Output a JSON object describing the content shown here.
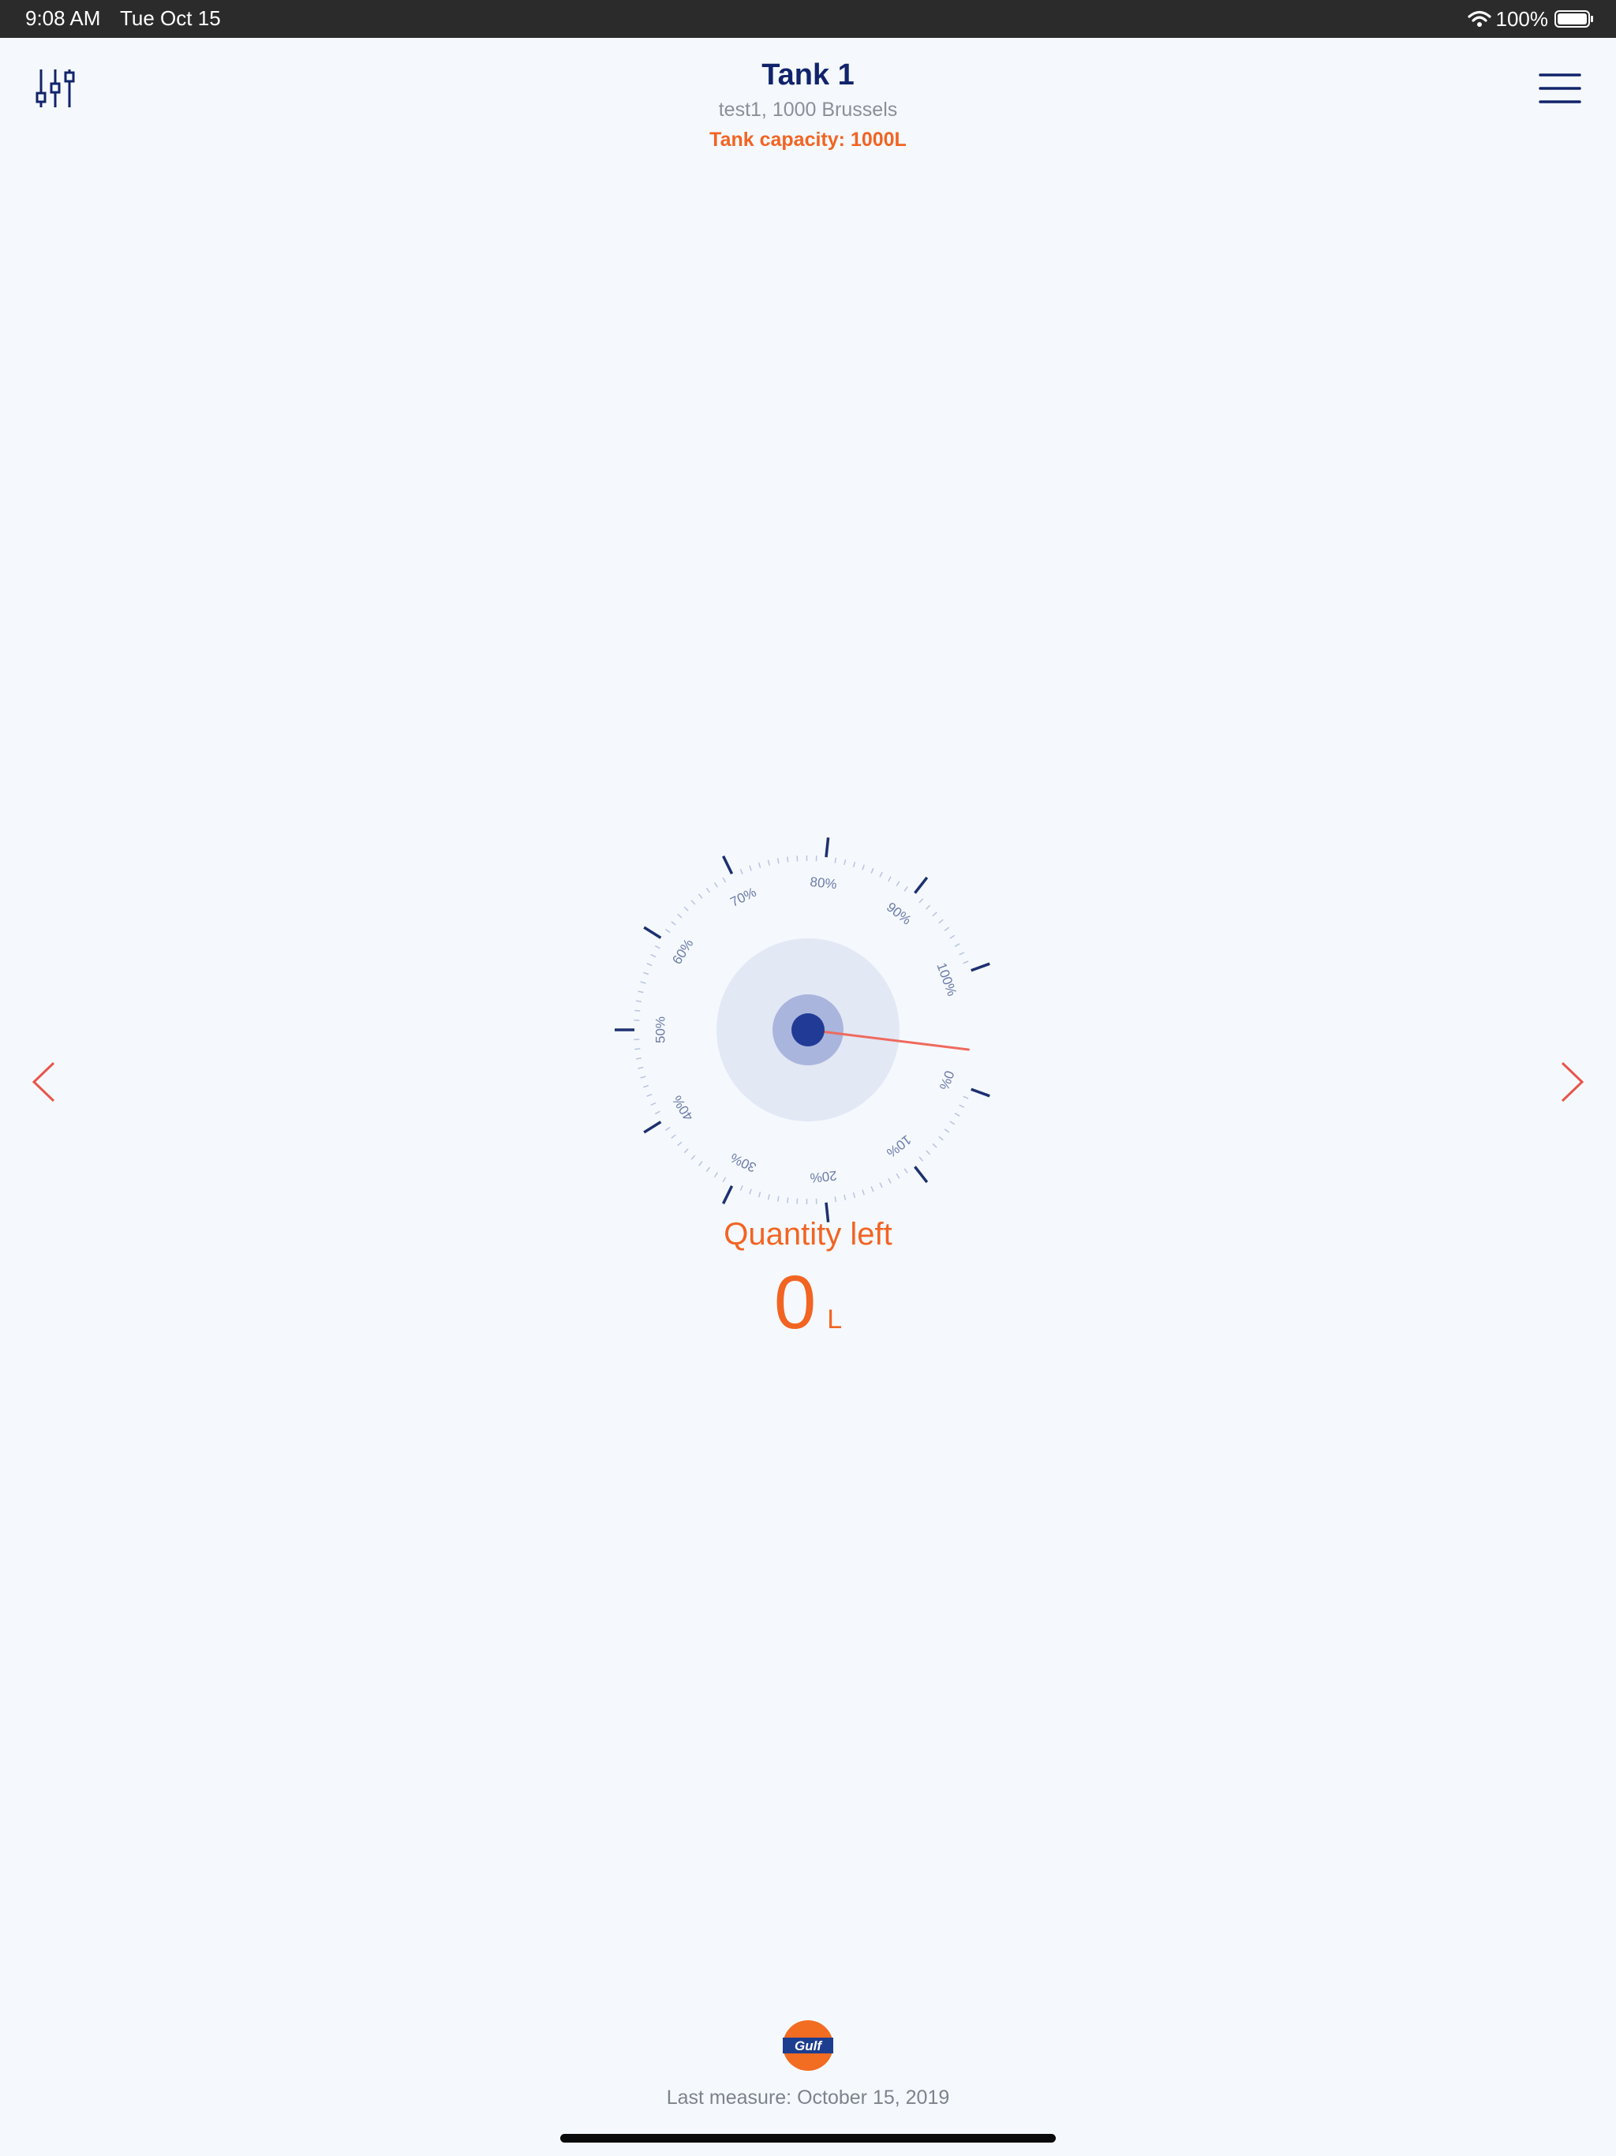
{
  "status_bar": {
    "time": "9:08 AM",
    "date": "Tue Oct 15",
    "battery": "100%"
  },
  "header": {
    "title": "Tank 1",
    "subtitle": "test1, 1000 Brussels",
    "capacity": "Tank capacity: 1000L"
  },
  "gauge": {
    "fraction": 0,
    "ticks": [
      "0%",
      "10%",
      "20%",
      "30%",
      "40%",
      "50%",
      "60%",
      "70%",
      "80%",
      "90%",
      "100%"
    ]
  },
  "quantity": {
    "label": "Quantity left",
    "value": "0",
    "unit": "L"
  },
  "footer": {
    "logo": "Gulf",
    "last_measure": "Last measure:  October 15, 2019"
  },
  "colors": {
    "accent_orange": "#f26422",
    "navy": "#11246b",
    "nav_arrow_red": "#e8554a",
    "background": "#f5f9fe"
  },
  "icons": [
    "settings-sliders-icon",
    "hamburger-menu-icon",
    "chevron-left-icon",
    "chevron-right-icon",
    "wifi-icon",
    "battery-icon"
  ]
}
